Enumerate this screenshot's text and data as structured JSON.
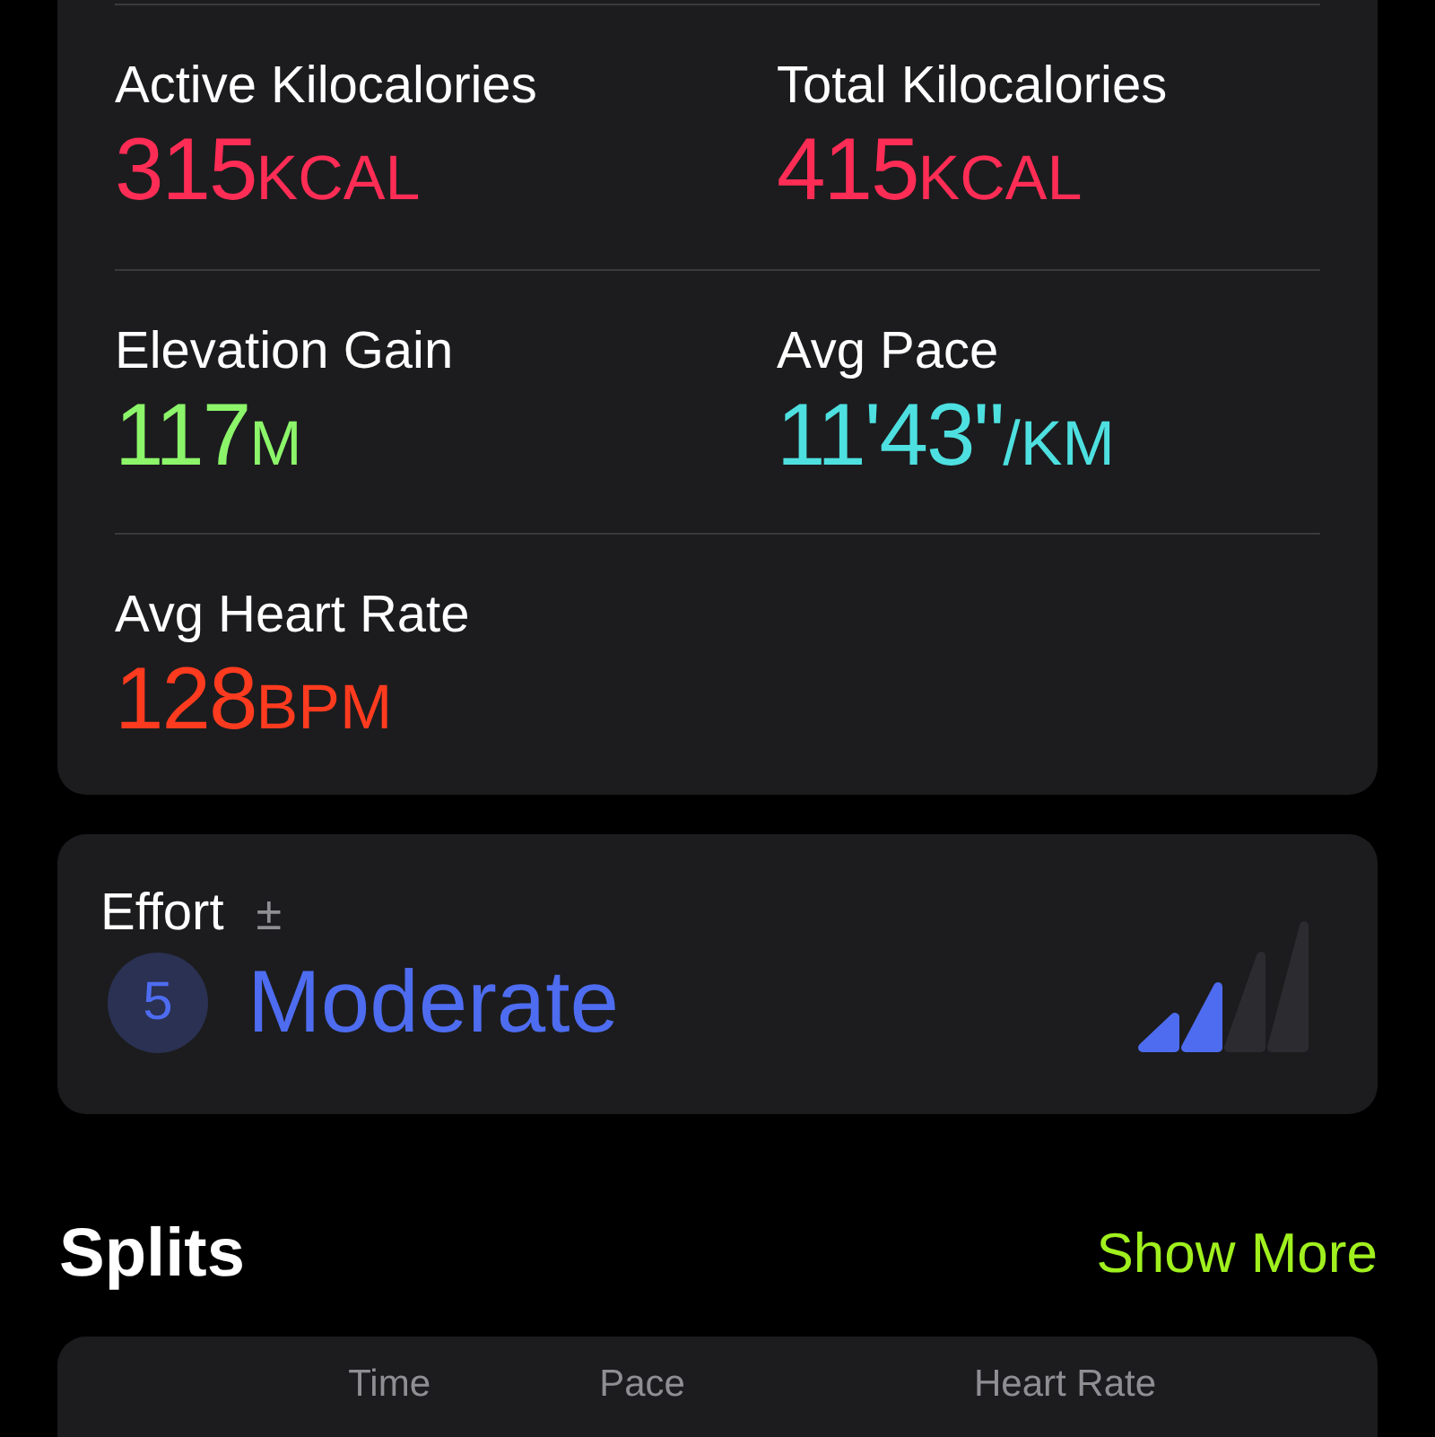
{
  "metrics": [
    {
      "label": "Active Kilocalories",
      "value": "315",
      "unit": "KCAL",
      "color": "#ff2d55"
    },
    {
      "label": "Total Kilocalories",
      "value": "415",
      "unit": "KCAL",
      "color": "#ff2d55"
    },
    {
      "label": "Elevation Gain",
      "value": "117",
      "unit": "M",
      "color": "#8cf56a"
    },
    {
      "label": "Avg Pace",
      "value": "11'43\"",
      "unit": "/KM",
      "color": "#4ee0e0"
    },
    {
      "label": "Avg Heart Rate",
      "value": "128",
      "unit": "BPM",
      "color": "#ff3b1f"
    }
  ],
  "effort": {
    "title": "Effort",
    "adjust_symbol": "±",
    "score": "5",
    "rating": "Moderate",
    "level": 0.5
  },
  "splits": {
    "title": "Splits",
    "show_more": "Show More",
    "columns": [
      "Time",
      "Pace",
      "Heart Rate"
    ]
  }
}
